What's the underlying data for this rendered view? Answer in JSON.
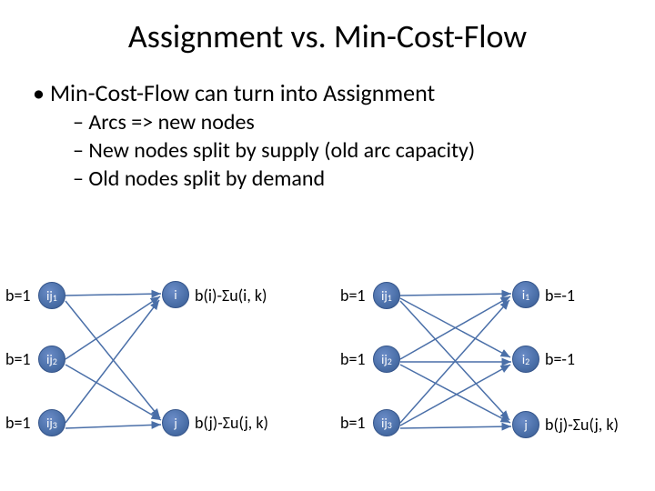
{
  "title": "Assignment vs. Min-Cost-Flow",
  "bulletMain": "Min-Cost-Flow can turn into Assignment",
  "sub1": "Arcs  =>  new nodes",
  "sub2": "New nodes split by supply (old arc capacity)",
  "sub3": "Old nodes split by demand",
  "b1": "b=1",
  "bm1": "b=-1",
  "ij1": "ij",
  "ij1s": "1",
  "ij2": "ij",
  "ij2s": "2",
  "ij3": "ij",
  "ij3s": "3",
  "iLabel": "i",
  "jLabel": "j",
  "i1": "i",
  "i1s": "1",
  "i2": "i",
  "i2s": "2",
  "formula_i": "b(i)-Σu(i, k)",
  "formula_j": "b(j)-Σu(j, k)"
}
